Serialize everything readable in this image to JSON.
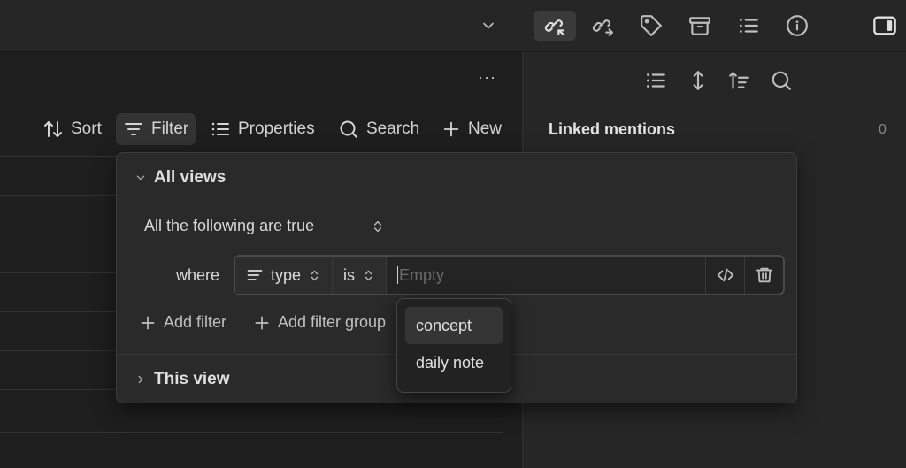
{
  "toolbar": {
    "sort_label": "Sort",
    "filter_label": "Filter",
    "properties_label": "Properties",
    "search_label": "Search",
    "new_label": "New",
    "more_label": "···"
  },
  "right_pane": {
    "linked_mentions_label": "Linked mentions",
    "linked_mentions_count": "0"
  },
  "filter_popup": {
    "all_views_label": "All views",
    "condition_label": "All the following are true",
    "where_label": "where",
    "property_label": "type",
    "operator_label": "is",
    "value_placeholder": "Empty",
    "add_filter_label": "Add filter",
    "add_filter_group_label": "Add filter group",
    "this_view_label": "This view"
  },
  "dropdown": {
    "options": [
      "concept",
      "daily note"
    ]
  },
  "colors": {
    "background": "#1e1e1e",
    "panel": "#262626",
    "popup": "#2a2a2a",
    "text": "#dadada"
  }
}
